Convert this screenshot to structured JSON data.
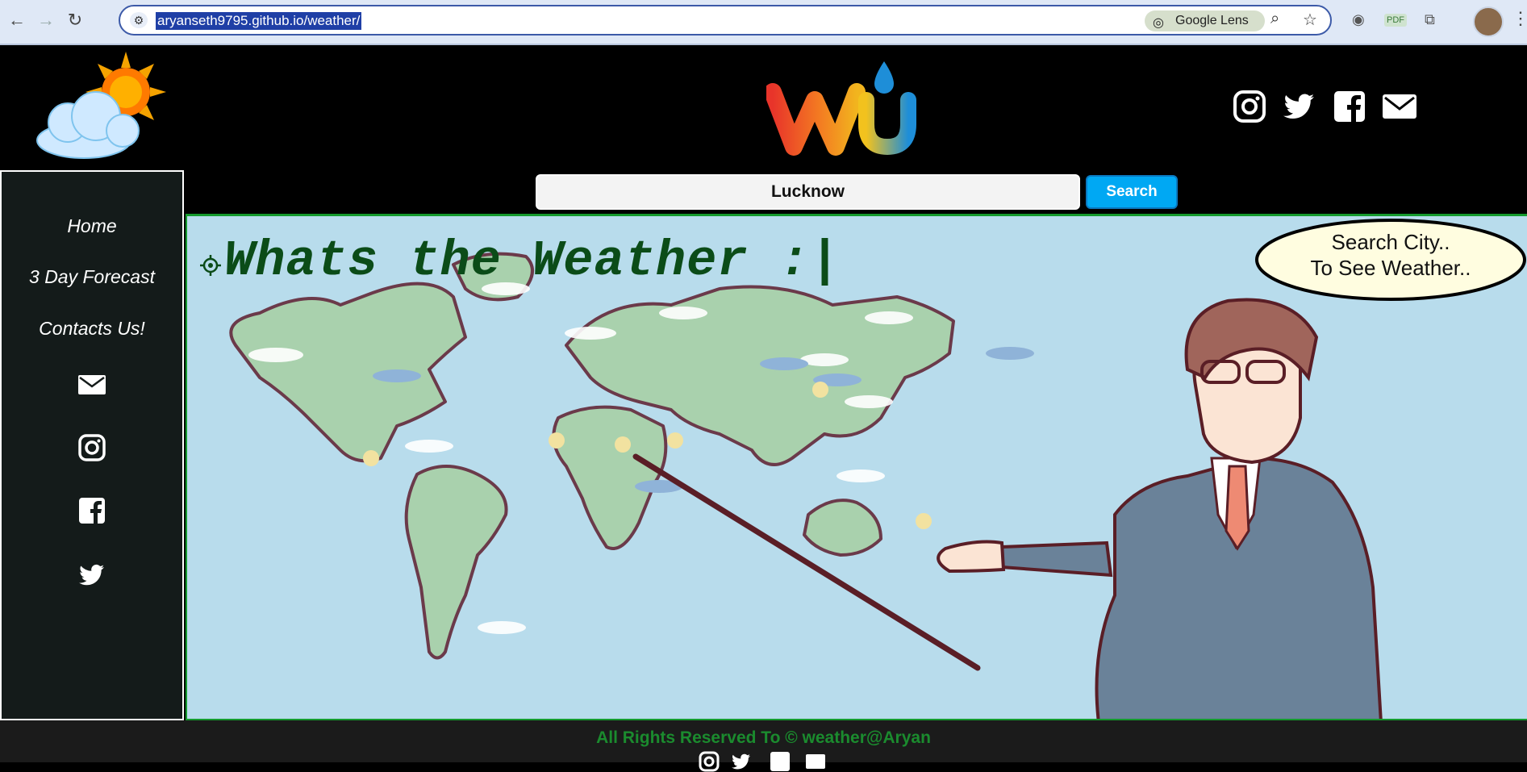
{
  "browser": {
    "url": "aryanseth9795.github.io/weather/",
    "lens_label": "Google Lens",
    "extension_badge": "PDF"
  },
  "header": {
    "search_value": "Lucknow",
    "search_button": "Search"
  },
  "sidebar": {
    "links": [
      "Home",
      "3 Day Forecast",
      "Contacts Us!"
    ]
  },
  "hero": {
    "title": "Whats the Weather :|",
    "bubble_line1": "Search City..",
    "bubble_line2": "To See Weather.."
  },
  "footer": {
    "text": "All Rights Reserved To © weather@Aryan"
  },
  "colors": {
    "accent_green": "#149a2d",
    "title_green": "#0b4c18",
    "search_blue": "#00a8f3",
    "hero_bg": "#b8dcec"
  }
}
